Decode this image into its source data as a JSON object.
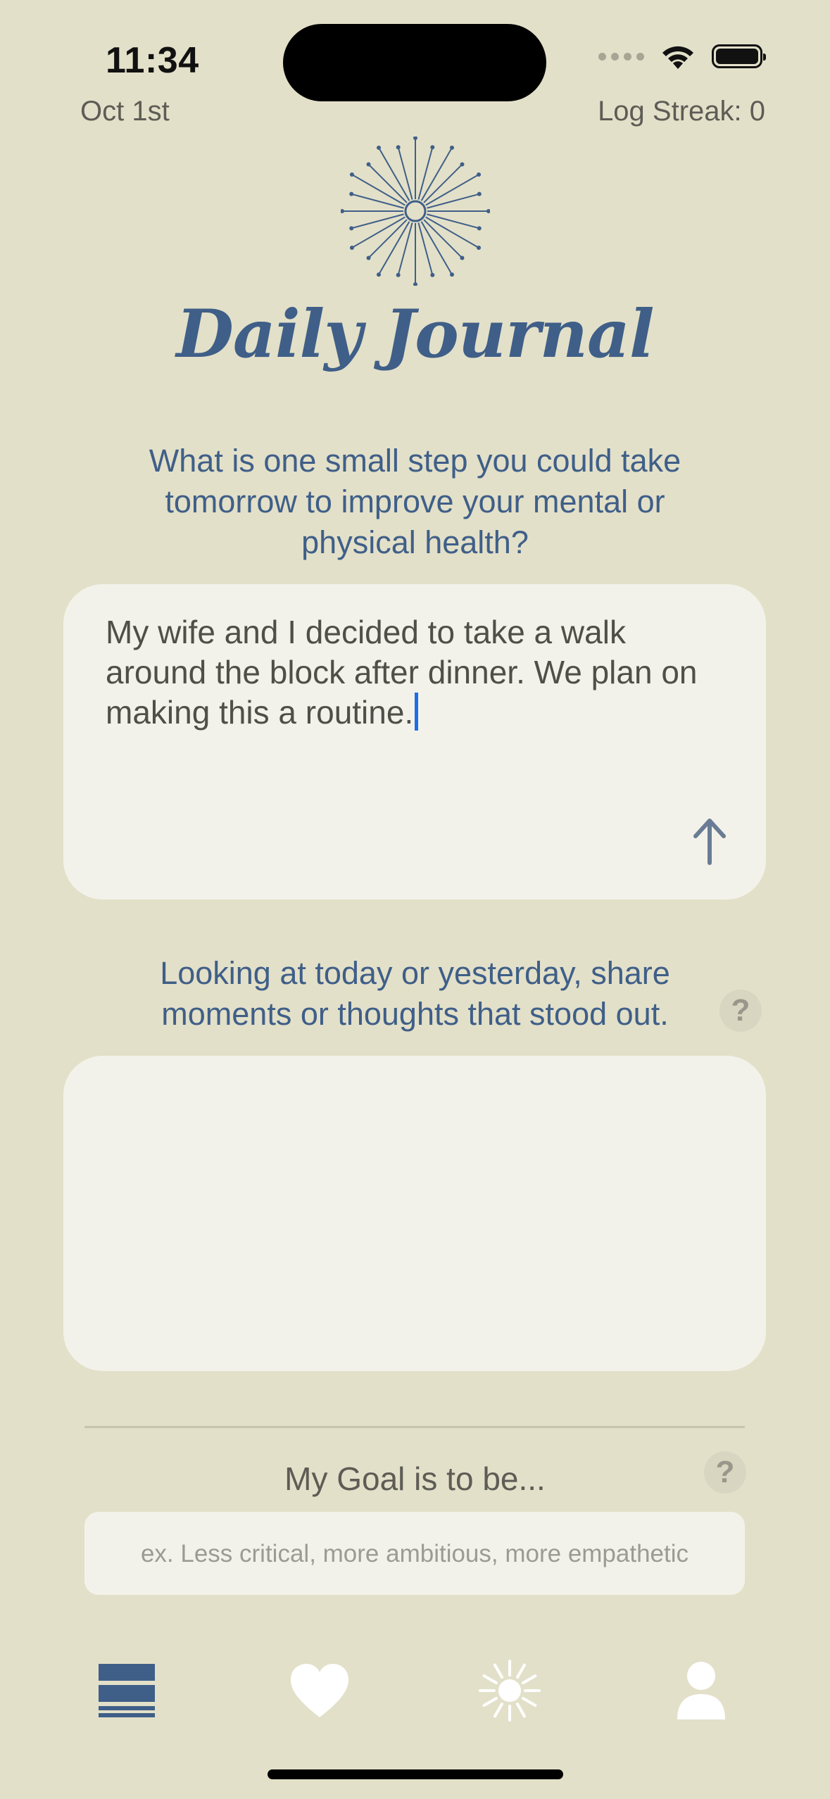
{
  "status_bar": {
    "time": "11:34",
    "icons": [
      "signal-dots-icon",
      "wifi-icon",
      "battery-icon"
    ]
  },
  "header": {
    "date": "Oct 1st",
    "streak": "Log Streak: 0",
    "title": "Daily Journal",
    "logo_icon": "starburst-icon"
  },
  "prompt1": {
    "question": "What is one small step you could take tomorrow to improve your mental or physical health?",
    "answer": "My wife and I decided to take a walk around the block after dinner. We plan on making this a routine.",
    "submit_icon": "arrow-up-icon"
  },
  "prompt2": {
    "question": "Looking at today or yesterday, share moments or thoughts that stood out.",
    "help_label": "?",
    "answer": ""
  },
  "goal": {
    "label": "My Goal is to be...",
    "help_label": "?",
    "placeholder": "ex. Less critical, more ambitious, more empathetic"
  },
  "tab_bar": {
    "items": [
      {
        "icon": "journal-list-icon",
        "active": true
      },
      {
        "icon": "heart-icon",
        "active": false
      },
      {
        "icon": "sun-icon",
        "active": false
      },
      {
        "icon": "profile-icon",
        "active": false
      }
    ]
  },
  "colors": {
    "background": "#e3e0c9",
    "accent": "#3f5f88",
    "card": "#f3f2ea",
    "caret": "#1b6fe6"
  }
}
